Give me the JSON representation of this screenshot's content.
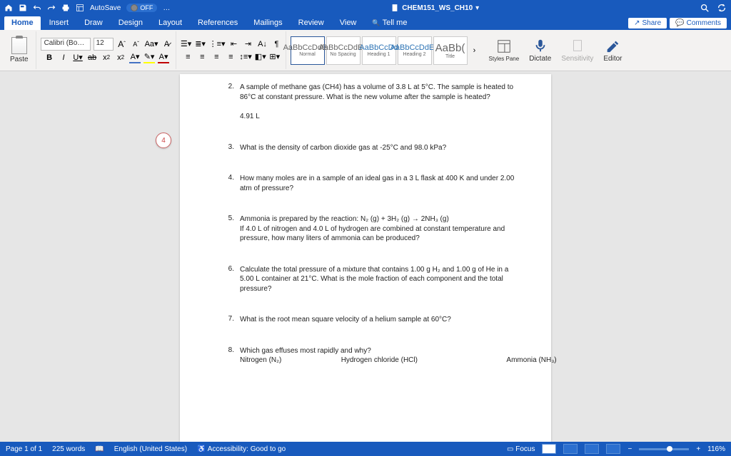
{
  "title": "CHEM151_WS_CH10",
  "autosave_label": "AutoSave",
  "autosave_state": "OFF",
  "tabs": [
    "Home",
    "Insert",
    "Draw",
    "Design",
    "Layout",
    "References",
    "Mailings",
    "Review",
    "View",
    "Tell me"
  ],
  "active_tab": 0,
  "share_label": "Share",
  "comments_label": "Comments",
  "font_name": "Calibri (Bo…",
  "font_size": "12",
  "paste_label": "Paste",
  "styles": [
    {
      "sample": "AaBbCcDdEe",
      "name": "Normal"
    },
    {
      "sample": "AaBbCcDdEe",
      "name": "No Spacing"
    },
    {
      "sample": "AaBbCcDd",
      "name": "Heading 1"
    },
    {
      "sample": "AaBbCcDdEe",
      "name": "Heading 2"
    },
    {
      "sample": "AaBb(",
      "name": "Title"
    }
  ],
  "stylespane_label": "Styles Pane",
  "dictate_label": "Dictate",
  "sensitivity_label": "Sensitivity",
  "editor_label": "Editor",
  "comment_badge": "4",
  "questions": [
    {
      "n": "2.",
      "text": "A sample of methane gas (CH4) has a volume of 3.8 L at 5°C. The sample is heated to 86°C at constant pressure. What is the new volume after the sample is heated?",
      "answer": "4.91 L"
    },
    {
      "n": "3.",
      "text": "What is the density of carbon dioxide gas at -25°C and 98.0 kPa?"
    },
    {
      "n": "4.",
      "text": "How many moles are in a sample of an ideal gas in a 3 L flask at 400 K and under 2.00 atm of pressure?"
    },
    {
      "n": "5.",
      "text": "Ammonia is prepared by the reaction: N₂ (g) + 3H₂ (g) → 2NH₃ (g)\nIf 4.0 L of nitrogen and 4.0 L of hydrogen are combined at constant temperature and pressure, how many liters of ammonia can be produced?"
    },
    {
      "n": "6.",
      "text": "Calculate the total pressure of a mixture that contains 1.00 g H₂ and 1.00 g of He in a 5.00 L container at 21°C. What is the mole fraction of each component and the total pressure?"
    },
    {
      "n": "7.",
      "text": "What is the root mean square velocity of a helium sample at 60°C?"
    },
    {
      "n": "8.",
      "text": "Which gas effuses most rapidly and why?",
      "row": "Nitrogen (N₂)                              Hydrogen chloride (HCl)                                             Ammonia (NH₃)"
    }
  ],
  "status": {
    "page": "Page 1 of 1",
    "words": "225 words",
    "lang": "English (United States)",
    "a11y": "Accessibility: Good to go",
    "focus": "Focus",
    "zoom": "116%"
  }
}
